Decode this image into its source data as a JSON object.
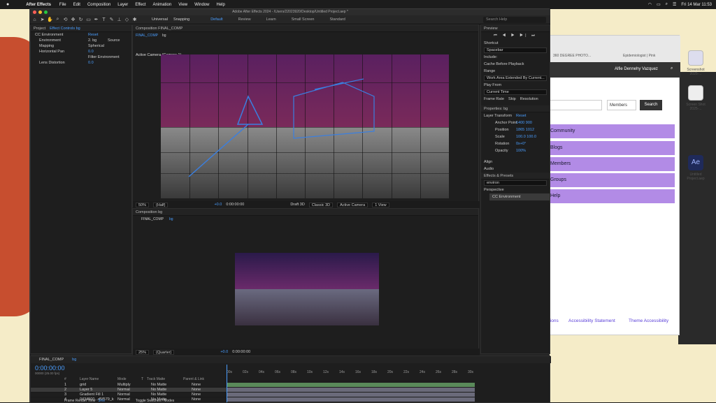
{
  "menubar": {
    "app": "After Effects",
    "items": [
      "File",
      "Edit",
      "Composition",
      "Layer",
      "Effect",
      "Animation",
      "View",
      "Window",
      "Help"
    ],
    "datetime": "Fri 14 Mar  11:53"
  },
  "window": {
    "title": "Adobe After Effects 2024 - /Users/22023920/Desktop/Untitled Project.aep *"
  },
  "toolbar": {
    "universal": "Universal",
    "snapping": "Snapping",
    "workspaces": [
      "Default",
      "Review",
      "Learn",
      "Small Screen",
      "Standard"
    ],
    "search_placeholder": "Search Help"
  },
  "left_panel": {
    "tabs": [
      "Project",
      "Effect Controls bg"
    ],
    "comp_path": "FINAL_COMP • bg",
    "effect": {
      "name": "CC Environment",
      "reset": "Reset"
    },
    "props": [
      {
        "label": "Environment",
        "value": "2. bg",
        "value2": "Source"
      },
      {
        "label": "Mapping",
        "value": "Spherical"
      },
      {
        "label": "Horizontal Pan",
        "value": "0.0"
      },
      {
        "label": "",
        "value": "Filter Environment"
      },
      {
        "label": "Lens Distortion",
        "value": "0.0"
      }
    ]
  },
  "comp1": {
    "tab": "Composition FINAL_COMP",
    "breadcrumbs": [
      "FINAL_COMP",
      "bg"
    ],
    "view_label": "Active Camera (Camera 1)",
    "zoom": "50%",
    "resolution": "(Half)",
    "exposure": "+0.0",
    "timecode": "0:00:00:00",
    "renderer": "Draft 3D",
    "renderer3d": "Classic 3D",
    "camera": "Active Camera",
    "views": "1 View"
  },
  "comp2": {
    "tab": "Composition bg",
    "breadcrumbs": [
      "FINAL_COMP",
      "bg"
    ],
    "zoom": "25%",
    "resolution": "(Quarter)",
    "exposure": "+0.0",
    "timecode": "0:00:00:00"
  },
  "right_panel": {
    "preview": "Preview",
    "shortcut_label": "Shortcut",
    "shortcut": "Spacebar",
    "include": "Include:",
    "cache": "Cache Before Playback",
    "range_label": "Range",
    "range": "Work Area Extended By Current...",
    "play_from_label": "Play From",
    "play_from": "Current Time",
    "frame_rate": "Frame Rate",
    "skip": "Skip",
    "resolution": "Resolution",
    "properties": "Properties: bg",
    "layer_transform": "Layer Transform",
    "reset": "Reset",
    "transform": [
      {
        "label": "Anchor Point",
        "value": "1400  900"
      },
      {
        "label": "Position",
        "value": "1865  1012"
      },
      {
        "label": "Scale",
        "value": "100.0  100.0"
      },
      {
        "label": "Rotation",
        "value": "0x+0°"
      },
      {
        "label": "Opacity",
        "value": "100%"
      }
    ],
    "align": "Align",
    "audio": "Audio",
    "effects_presets": "Effects & Presets",
    "search_value": "environ",
    "tree_parent": "Perspective",
    "tree_child": "CC Environment"
  },
  "timeline": {
    "tabs": [
      "FINAL_COMP",
      "bg"
    ],
    "timecode": "0:00:00:00",
    "frame_info": "00000 (25.00 fps)",
    "columns": [
      "#",
      "Layer Name",
      "Mode",
      "T",
      "Track Matte",
      "Parent & Link"
    ],
    "layers": [
      {
        "num": "1",
        "name": "grid",
        "mode": "Multiply",
        "matte": "No Matte",
        "parent": "None"
      },
      {
        "num": "2",
        "name": "Layer 5",
        "mode": "Normal",
        "matte": "No Matte",
        "parent": "None"
      },
      {
        "num": "3",
        "name": "Gradient Fill 1",
        "mode": "Normal",
        "matte": "No Matte",
        "parent": "None"
      },
      {
        "num": "4",
        "name": "0434500...d5f579_k",
        "mode": "Normal",
        "matte": "No Matte",
        "parent": "None"
      }
    ],
    "ruler": [
      "00s",
      "02s",
      "04s",
      "06s",
      "08s",
      "10s",
      "12s",
      "14s",
      "16s",
      "18s",
      "20s",
      "22s",
      "24s",
      "26s",
      "28s",
      "30s"
    ],
    "footer_left": "Frame Render Time",
    "footer_ms": "3ms",
    "footer_mid": "Toggle Switches / Modes"
  },
  "browser": {
    "tab_text": "Epidemiologist | Pink",
    "tab_left": "360 DEGREE PHOTO...",
    "user": "Alfie Dennehy Vazquez",
    "search_select": "Members",
    "search_button": "Search",
    "nav": [
      "Community",
      "Blogs",
      "Members",
      "Groups",
      "Help"
    ],
    "footer_links": [
      "tions",
      "Accessibility Statement",
      "Theme Accessibility"
    ]
  },
  "desktop_icons": [
    {
      "label": "Screenshot 2025-...",
      "color": "#dde"
    },
    {
      "label": "Screen Shot 2025-...",
      "color": "#eee"
    },
    {
      "label": "Untitled Project.aep",
      "color": "#1f2a5a",
      "text": "Ae"
    }
  ]
}
